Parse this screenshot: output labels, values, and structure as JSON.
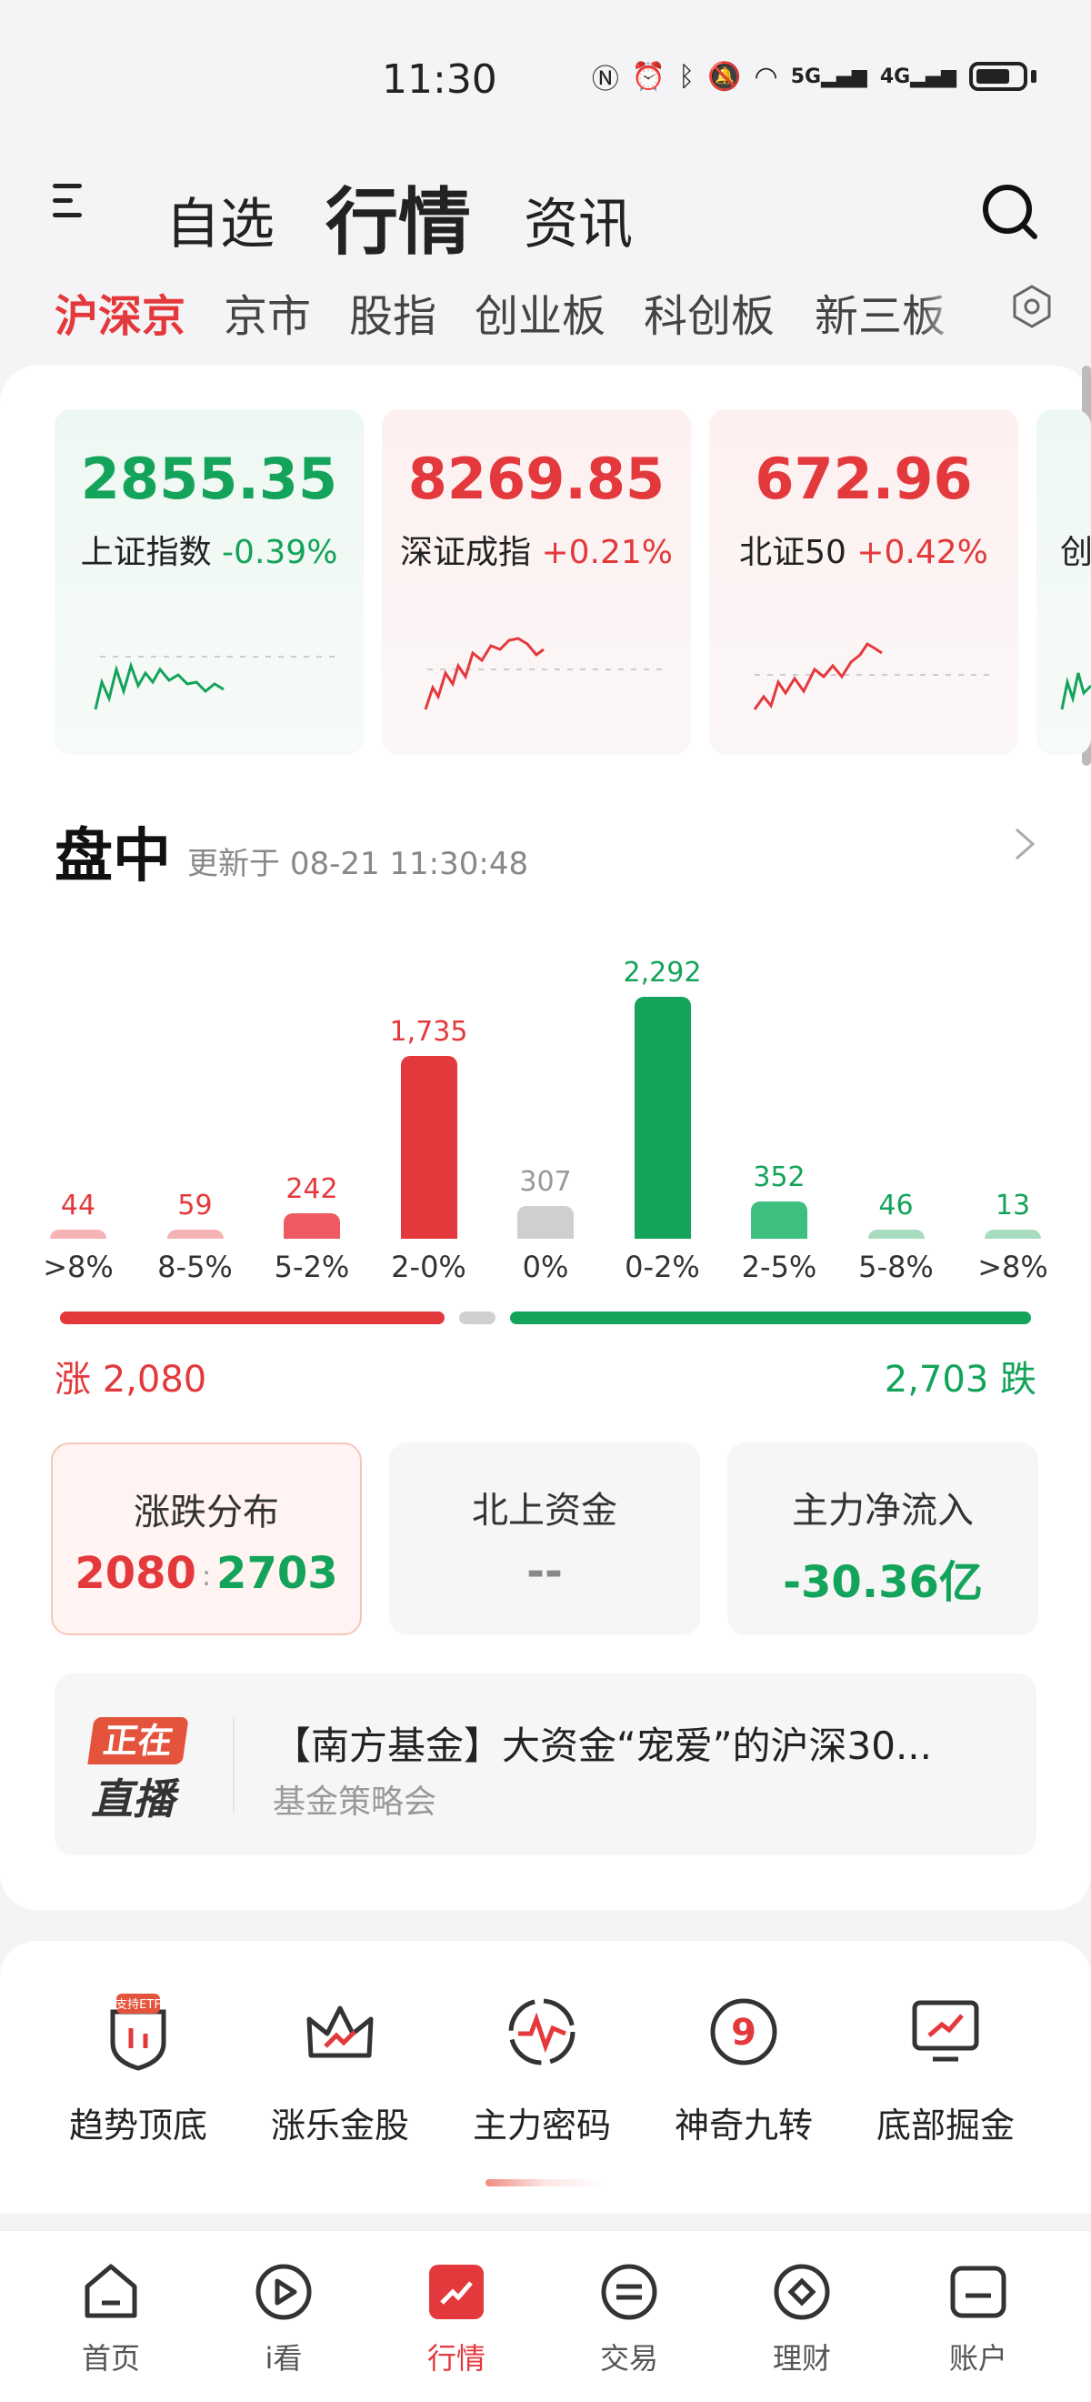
{
  "status_bar": {
    "time": "11:30",
    "signal_a": "5G",
    "signal_b": "4G"
  },
  "header": {
    "tabs": [
      {
        "label": "自选"
      },
      {
        "label": "行情",
        "active": true
      },
      {
        "label": "资讯"
      }
    ]
  },
  "market_tabs": [
    {
      "label": "沪深京",
      "active": true
    },
    {
      "label": "京市"
    },
    {
      "label": "股指"
    },
    {
      "label": "创业板"
    },
    {
      "label": "科创板"
    },
    {
      "label": "新三板"
    }
  ],
  "indices": [
    {
      "value": "2855.35",
      "name": "上证指数",
      "change": "-0.39%",
      "trend": "down"
    },
    {
      "value": "8269.85",
      "name": "深证成指",
      "change": "+0.21%",
      "trend": "up"
    },
    {
      "value": "672.96",
      "name": "北证50",
      "change": "+0.42%",
      "trend": "up"
    },
    {
      "name_partial": "创"
    }
  ],
  "intraday": {
    "title": "盘中",
    "update_prefix": "更新于",
    "update_time": "08-21 11:30:48"
  },
  "distribution": {
    "bins": [
      {
        "label": ">8%",
        "count": 44,
        "display": "44",
        "color": "#e4393c"
      },
      {
        "label": "8-5%",
        "count": 59,
        "display": "59",
        "color": "#e4393c"
      },
      {
        "label": "5-2%",
        "count": 242,
        "display": "242",
        "color": "#e4393c"
      },
      {
        "label": "2-0%",
        "count": 1735,
        "display": "1,735",
        "color": "#e4393c"
      },
      {
        "label": "0%",
        "count": 307,
        "display": "307",
        "color": "#999999"
      },
      {
        "label": "0-2%",
        "count": 2292,
        "display": "2,292",
        "color": "#14a35a"
      },
      {
        "label": "2-5%",
        "count": 352,
        "display": "352",
        "color": "#14a35a"
      },
      {
        "label": "5-8%",
        "count": 46,
        "display": "46",
        "color": "#14a35a"
      },
      {
        "label": ">8%",
        "count": 13,
        "display": "13",
        "color": "#14a35a"
      }
    ],
    "up_label": "涨 2,080",
    "down_label": "2,703 跌",
    "up_count": 2080,
    "flat_count": 307,
    "down_count": 2703
  },
  "stats": [
    {
      "title": "涨跌分布",
      "value_up": "2080",
      "value_down": "2703",
      "active": true
    },
    {
      "title": "北上资金",
      "value": "--"
    },
    {
      "title": "主力净流入",
      "value": "-30.36亿"
    }
  ],
  "live": {
    "badge_top": "正在",
    "badge_bottom": "直播",
    "title": "【南方基金】大资金“宠爱”的沪深30...",
    "subtitle": "基金策略会"
  },
  "tools": [
    {
      "label": "趋势顶底",
      "icon": "trend-shield-icon",
      "badge": "支持ETF"
    },
    {
      "label": "涨乐金股",
      "icon": "crown-icon"
    },
    {
      "label": "主力密码",
      "icon": "pulse-circle-icon"
    },
    {
      "label": "神奇九转",
      "icon": "nine-circle-icon"
    },
    {
      "label": "底部掘金",
      "icon": "monitor-chart-icon"
    }
  ],
  "bottom_nav": [
    {
      "label": "首页",
      "icon": "home-icon"
    },
    {
      "label": "i看",
      "icon": "play-icon"
    },
    {
      "label": "行情",
      "icon": "market-icon",
      "active": true
    },
    {
      "label": "交易",
      "icon": "exchange-icon"
    },
    {
      "label": "理财",
      "icon": "wealth-icon"
    },
    {
      "label": "账户",
      "icon": "account-icon"
    }
  ],
  "colors": {
    "up": "#e4393c",
    "down": "#14a35a",
    "flat": "#999999"
  }
}
